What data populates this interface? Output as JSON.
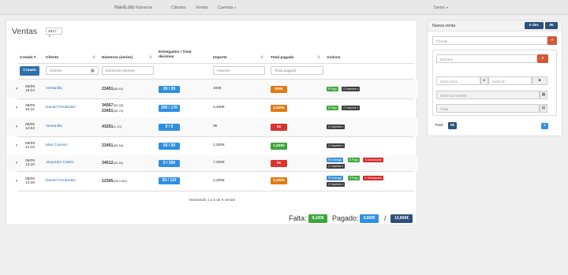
{
  "nav": {
    "brand": "NaviLoto",
    "items": [
      "Números",
      "Clientes",
      "Ventas",
      "Cuentas"
    ],
    "user": "Demo"
  },
  "page": {
    "title": "Ventas",
    "year": "2017"
  },
  "columns": [
    "Creado",
    "Cliente",
    "Números (series)",
    "Entregados / Total décimos",
    "Importe",
    "Total pagado",
    "Actions"
  ],
  "filters": {
    "creado_btn": "Creado",
    "cliente_ph": "Cliente",
    "numeros_ph": "Números (series)",
    "importe_ph": "Importe",
    "total_ph": "Total pagado"
  },
  "rows": [
    {
      "date": "08/09",
      "time": "16:04",
      "client": "Ventanilla",
      "numbers": [
        {
          "n": "23451",
          "s": "(50-61)"
        }
      ],
      "entregados": "20 / 20",
      "importe": "400€",
      "pagado": "300€",
      "pagado_color": "#e07a14",
      "actions": [
        "Pago",
        "Imprimir"
      ]
    },
    {
      "date": "08/09",
      "time": "15:11",
      "client": "Daniel Fernández",
      "numbers": [
        {
          "n": "34567",
          "s": "(50-55)"
        },
        {
          "n": "23451",
          "s": "(50-70)"
        }
      ],
      "entregados": "200 / 170",
      "importe": "3,400€",
      "pagado": "2,500€",
      "pagado_color": "#e07a14",
      "actions": [
        "Pago",
        "Imprimir"
      ]
    },
    {
      "date": "08/09",
      "time": "14:53",
      "client": "Ventanilla",
      "numbers": [
        {
          "n": "43251",
          "s": "(1-10)"
        }
      ],
      "entregados": "0 / 0",
      "importe": "0€",
      "pagado": "0€",
      "pagado_color": "#d9332e",
      "actions": [
        "Imprimir"
      ]
    },
    {
      "date": "08/09",
      "time": "14:42",
      "client": "Mari Carmen",
      "numbers": [
        {
          "n": "23451",
          "s": "(50-54)"
        }
      ],
      "entregados": "50 / 50",
      "importe": "1,000€",
      "pagado": "1,000€",
      "pagado_color": "#3ca63c",
      "actions": [
        "Imprimir"
      ]
    },
    {
      "date": "08/09",
      "time": "14:40",
      "client": "Alejandro Castro",
      "numbers": [
        {
          "n": "34512",
          "s": "(20-54)"
        }
      ],
      "entregados": "0 / 350",
      "importe": "7,000€",
      "pagado": "0€",
      "pagado_color": "#d9332e",
      "actions": [
        "Entrega",
        "Pago",
        "Devolución",
        "Imprimir"
      ]
    },
    {
      "date": "08/09",
      "time": "14:40",
      "client": "Daniel Fernández",
      "numbers": [
        {
          "n": "12345",
          "s": "(150-160)"
        }
      ],
      "entregados": "50 / 110",
      "importe": "2,200€",
      "pagado": "1,900€",
      "pagado_color": "#e07a14",
      "actions": [
        "Entrega",
        "Pago",
        "Devolución",
        "Imprimir"
      ]
    }
  ],
  "footer": {
    "showing": "Mostrando 1 a 6 de 6 ventas",
    "falta_label": "Falta:",
    "falta": "9,100€",
    "pagado_label": "Pagado:",
    "pagado": "4,500€",
    "slash": "/",
    "total": "13,600€"
  },
  "sidebar": {
    "title": "Nueva venta",
    "badge_dec": "0 dec",
    "badge_eur": "0€",
    "cliente_ph": "Cliente",
    "numero_ph": "Número",
    "serie_inicio_ph": "Serie inicio",
    "serie_fin_ph": "Serie fin",
    "decimos_ph": "Décimos sueltos",
    "total_ph": "Total",
    "total_label": "Total:",
    "total_value": "0€"
  },
  "colors": {
    "blue": "#2f8fe2",
    "green": "#3ca63c",
    "orange": "#e07a14",
    "red": "#d9332e",
    "dark": "#2d4f7c",
    "primary": "#2f6fab"
  }
}
